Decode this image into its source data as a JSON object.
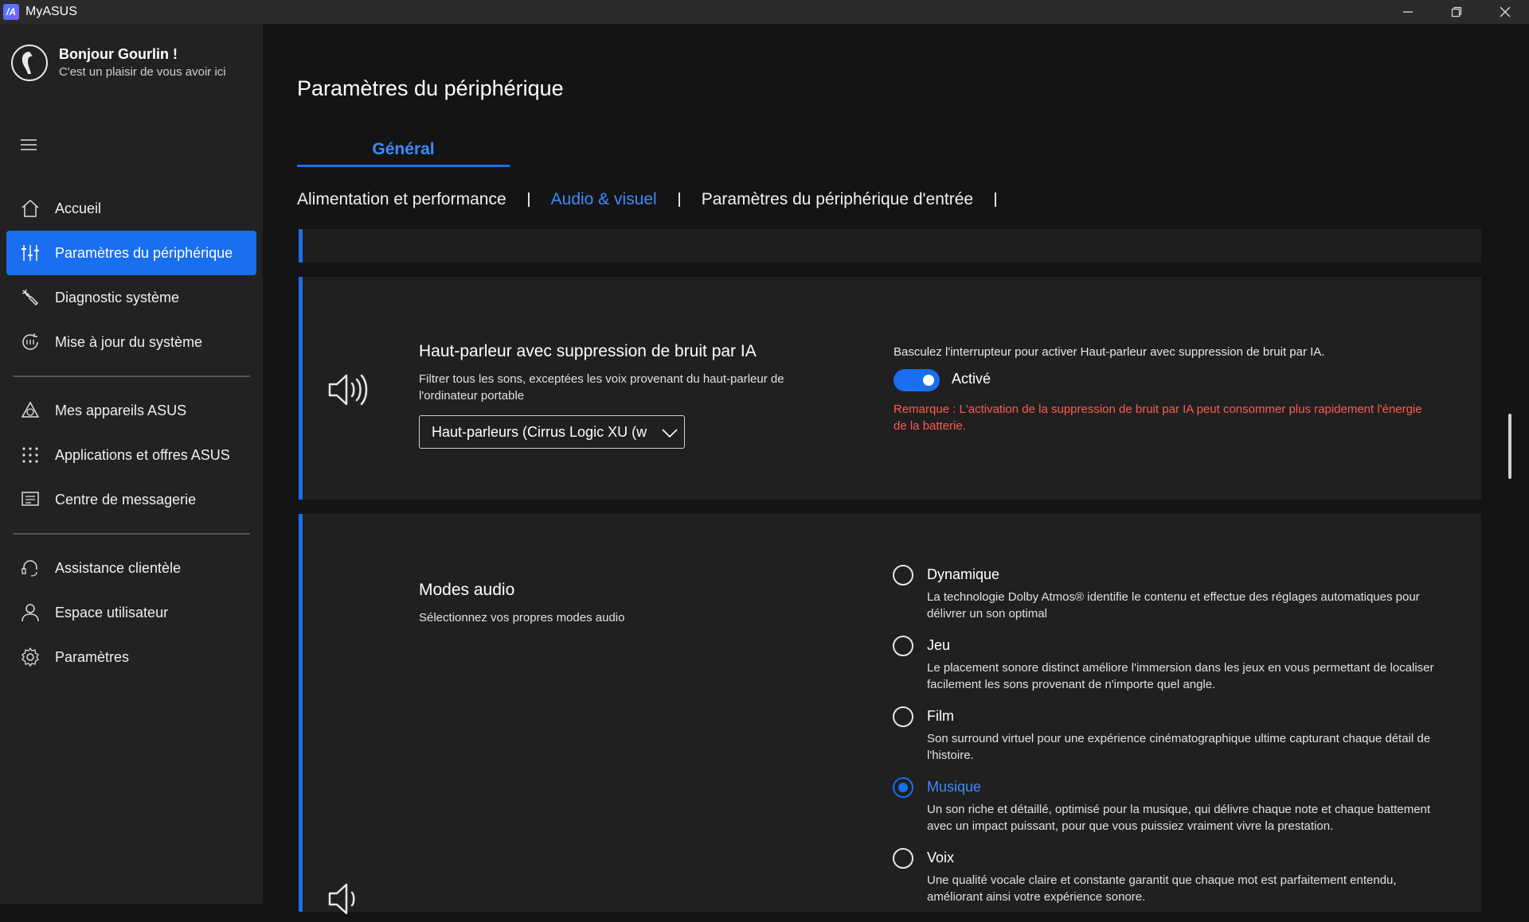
{
  "window": {
    "title": "MyASUS",
    "logo_text": "/A"
  },
  "user": {
    "greeting": "Bonjour Gourlin !",
    "subtitle": "C'est un plaisir de vous avoir ici"
  },
  "sidebar": {
    "group1": [
      {
        "label": "Accueil",
        "icon": "home-icon"
      },
      {
        "label": "Paramètres du périphérique",
        "icon": "sliders-icon",
        "active": true
      },
      {
        "label": "Diagnostic système",
        "icon": "wrench-icon"
      },
      {
        "label": "Mise à jour du système",
        "icon": "update-icon"
      }
    ],
    "group2": [
      {
        "label": "Mes appareils ASUS",
        "icon": "devices-icon"
      },
      {
        "label": "Applications et offres ASUS",
        "icon": "apps-grid-icon"
      },
      {
        "label": "Centre de messagerie",
        "icon": "message-icon"
      }
    ],
    "group3": [
      {
        "label": "Assistance clientèle",
        "icon": "headset-icon"
      },
      {
        "label": "Espace utilisateur",
        "icon": "user-icon"
      },
      {
        "label": "Paramètres",
        "icon": "gear-icon"
      }
    ]
  },
  "main": {
    "title": "Paramètres du périphérique",
    "tab": "Général",
    "subtabs": [
      "Alimentation et performance",
      "Audio & visuel",
      "Paramètres du périphérique d'entrée"
    ],
    "active_subtab": "Audio & visuel"
  },
  "noise_card": {
    "title": "Haut-parleur avec suppression de bruit par IA",
    "desc": "Filtrer tous les sons, exceptées les voix provenant du haut-parleur de l'ordinateur portable",
    "dropdown_value": "Haut-parleurs (Cirrus Logic XU (w",
    "toggle_instruction": "Basculez l'interrupteur pour activer Haut-parleur avec suppression de bruit par IA.",
    "toggle_label": "Activé",
    "toggle_on": true,
    "note": "Remarque : L'activation de la suppression de bruit par IA peut consommer plus rapidement l'énergie de la batterie."
  },
  "audio_modes": {
    "title": "Modes audio",
    "desc": "Sélectionnez vos propres modes audio",
    "selected": "Musique",
    "options": [
      {
        "label": "Dynamique",
        "desc": "La technologie Dolby Atmos® identifie le contenu et effectue des réglages automatiques pour délivrer un son optimal"
      },
      {
        "label": "Jeu",
        "desc": "Le placement sonore distinct améliore l'immersion dans les jeux en vous permettant de localiser facilement les sons provenant de n'importe quel angle."
      },
      {
        "label": "Film",
        "desc": "Son surround virtuel pour une expérience cinématographique ultime capturant chaque détail de l'histoire."
      },
      {
        "label": "Musique",
        "desc": "Un son riche et détaillé, optimisé pour la musique, qui délivre chaque note et chaque battement avec un impact puissant, pour que vous puissiez vraiment vivre la prestation."
      },
      {
        "label": "Voix",
        "desc": "Une qualité vocale claire et constante garantit que chaque mot est parfaitement entendu, améliorant ainsi votre expérience sonore."
      }
    ]
  },
  "colors": {
    "accent": "#1a6ef0",
    "accent_text": "#3d8bff",
    "warning": "#ff5a4f",
    "sidebar_bg": "#222222",
    "main_bg": "#141414"
  }
}
